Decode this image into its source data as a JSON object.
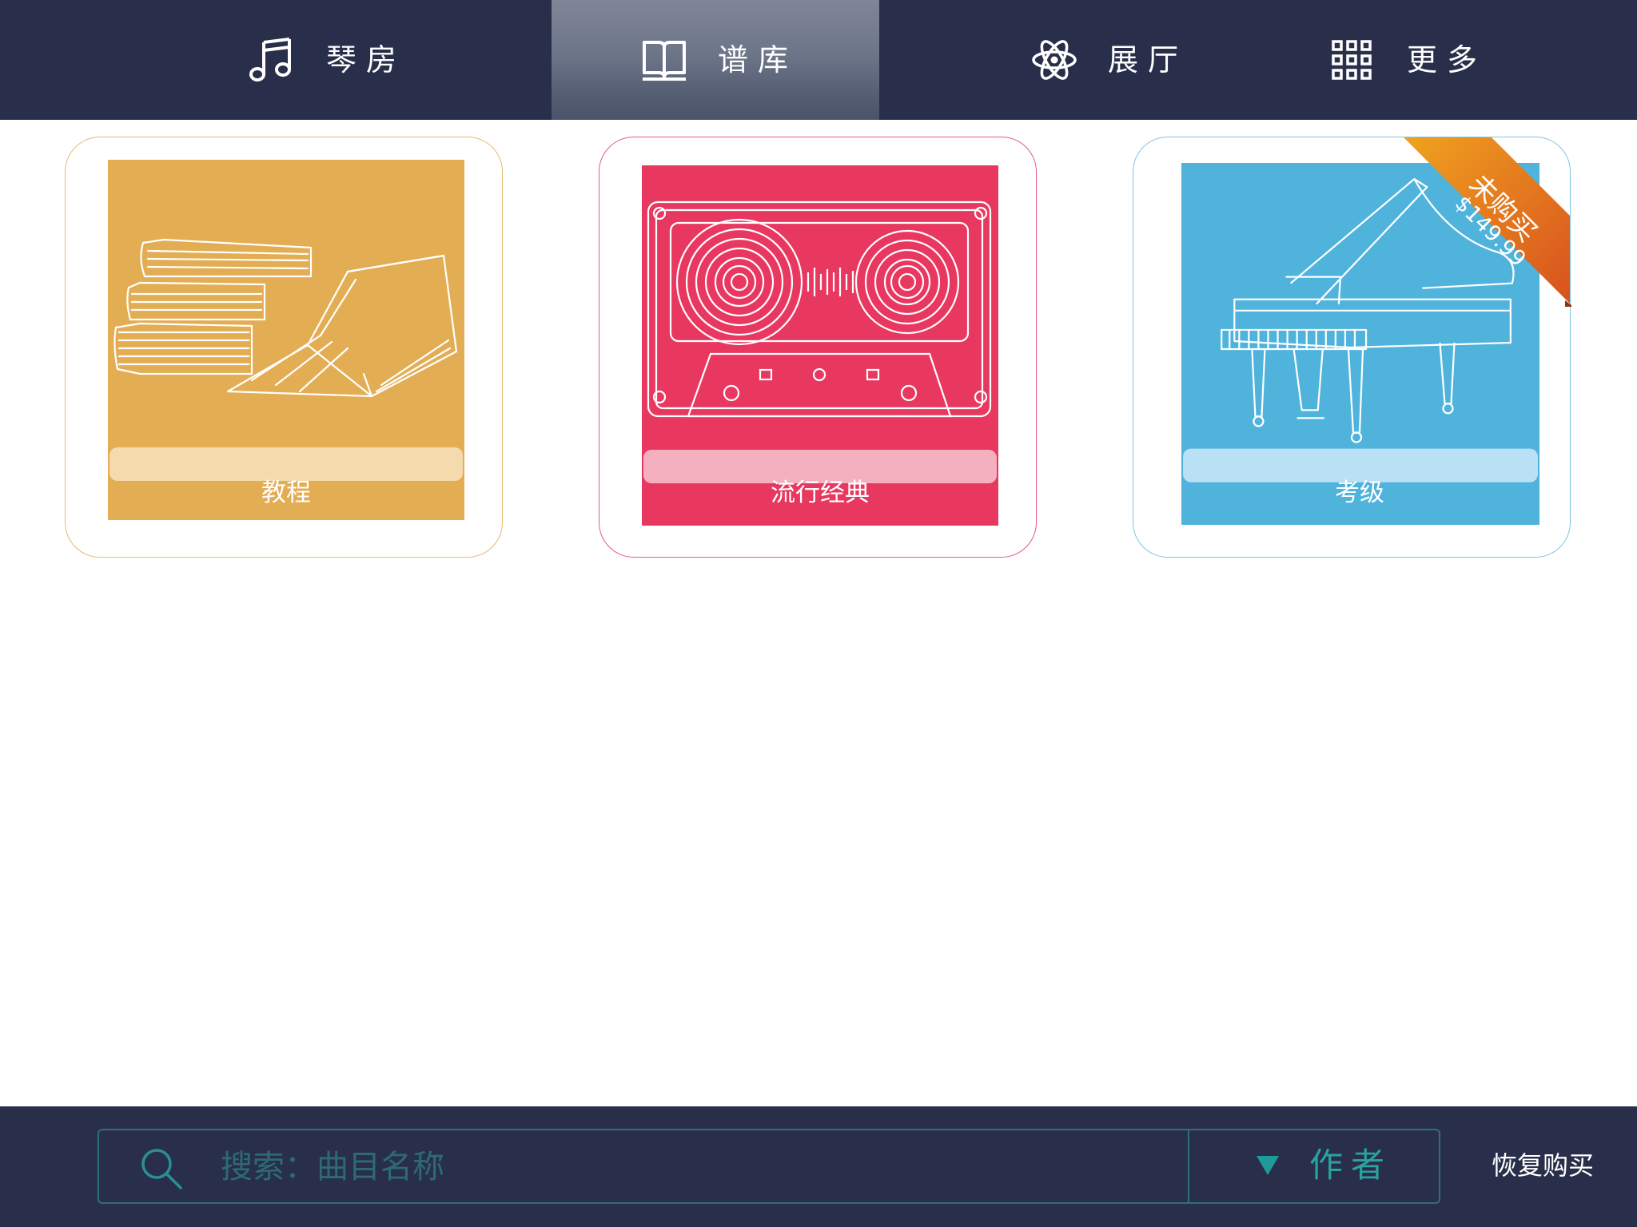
{
  "tabs": [
    {
      "label": "琴房",
      "icon": "music-note-icon",
      "active": false
    },
    {
      "label": "谱库",
      "icon": "open-book-icon",
      "active": true
    },
    {
      "label": "展厅",
      "icon": "atom-icon",
      "active": false
    },
    {
      "label": "更多",
      "icon": "grid-icon",
      "active": false
    }
  ],
  "categories": [
    {
      "label": "教程",
      "image": "books-illustration",
      "color": "#e3ad54"
    },
    {
      "label": "流行经典",
      "image": "cassette-tape-illustration",
      "color": "#e83860"
    },
    {
      "label": "考级",
      "image": "grand-piano-illustration",
      "color": "#4fb3dc",
      "badge": {
        "status": "未购买",
        "price": "$149.99"
      }
    }
  ],
  "search": {
    "placeholder": "搜索：曲目名称",
    "value": "",
    "filter_label": "作者"
  },
  "restore_purchase": "恢复购买",
  "colors": {
    "bar_bg": "#292f4a",
    "active_tab": "#6d7589",
    "accent_teal": "#2aa39f",
    "ribbon": "#e0781c"
  }
}
